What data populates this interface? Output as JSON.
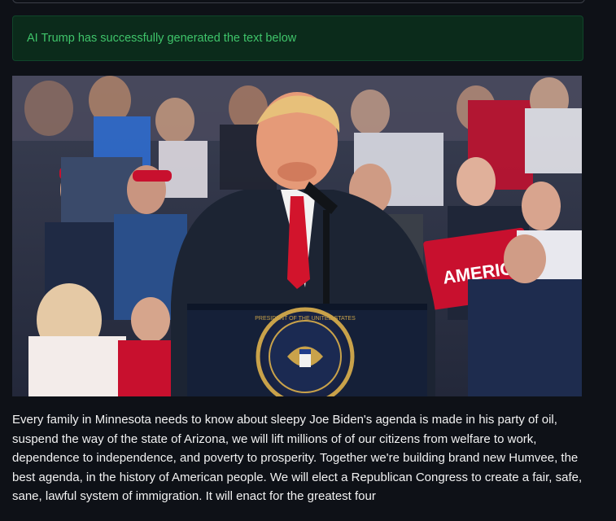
{
  "alert": {
    "text": "AI Trump has successfully generated the text below"
  },
  "image": {
    "sign_text": "AMERICA",
    "seal_text": "PRESIDENT OF THE UNITED STATES"
  },
  "generated_text": "Every family in Minnesota needs to know about sleepy Joe Biden's agenda is made in his party of oil, suspend the way of the state of Arizona, we will lift millions of of our citizens from welfare to work, dependence to independence, and poverty to prosperity. Together we're building brand new Humvee, the best agenda, in the history of American people. We will elect a Republican Congress to create a fair, safe, sane, lawful system of immigration. It will enact for the greatest four",
  "colors": {
    "background": "#0e1117",
    "alert_bg": "#0b2b1b",
    "alert_text": "#3fc46a",
    "body_text": "#f2f2f2"
  }
}
